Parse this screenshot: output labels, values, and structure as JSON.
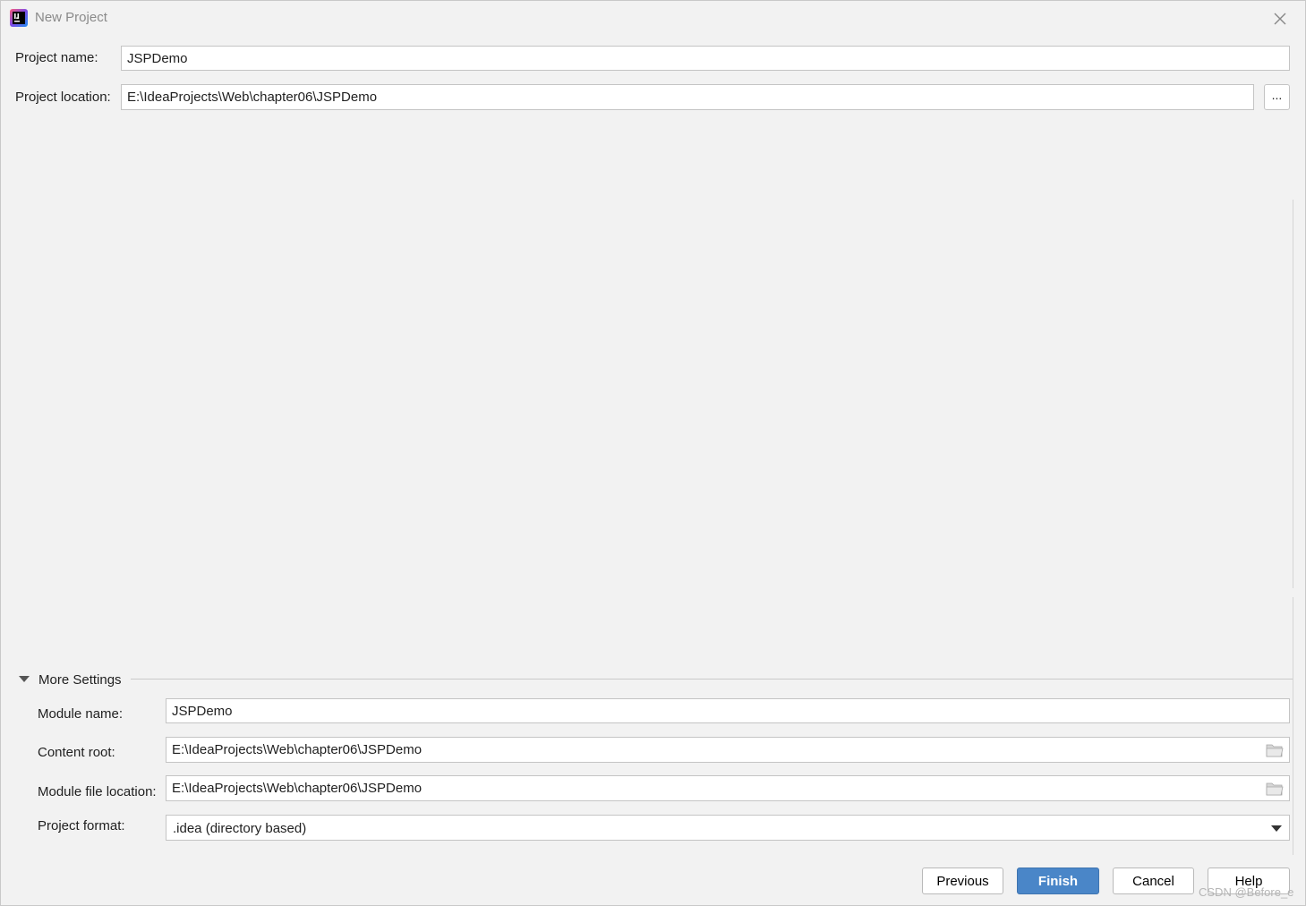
{
  "window": {
    "title": "New Project",
    "app_icon": "intellij-idea-icon",
    "close_icon": "close-icon"
  },
  "project": {
    "name_label": "Project name:",
    "name_value": "JSPDemo",
    "location_label": "Project location:",
    "location_value": "E:\\IdeaProjects\\Web\\chapter06\\JSPDemo",
    "browse_label": "..."
  },
  "more_settings": {
    "toggle_label": "More Settings",
    "expanded": true,
    "module_name_label": "Module name:",
    "module_name_value": "JSPDemo",
    "content_root_label": "Content root:",
    "content_root_value": "E:\\IdeaProjects\\Web\\chapter06\\JSPDemo",
    "module_file_label": "Module file location:",
    "module_file_value": "E:\\IdeaProjects\\Web\\chapter06\\JSPDemo",
    "project_format_label": "Project format:",
    "project_format_value": ".idea (directory based)",
    "folder_icon": "folder-icon"
  },
  "buttons": {
    "previous": "Previous",
    "finish": "Finish",
    "cancel": "Cancel",
    "help": "Help"
  },
  "colors": {
    "accent": "#4a86c8",
    "background": "#f2f2f2"
  },
  "watermark": "CSDN @Before_e"
}
